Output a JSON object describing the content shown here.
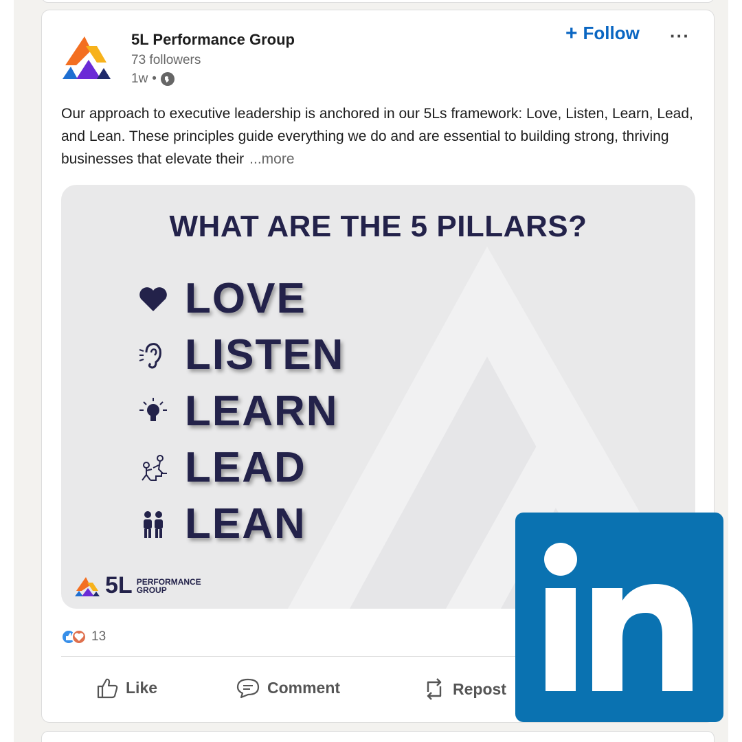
{
  "post": {
    "org_name": "5L Performance Group",
    "followers": "73 followers",
    "time": "1w",
    "separator": "•",
    "follow_label": "Follow",
    "more_menu": "···",
    "text": "Our approach to executive leadership is anchored in our 5Ls framework: Love, Listen, Learn, Lead, and Lean. These principles guide everything we do and are essential to building strong, thriving businesses that elevate their",
    "see_more": "...more"
  },
  "image": {
    "title": "WHAT ARE THE 5 PILLARS?",
    "pillars": [
      {
        "label": "LOVE",
        "icon": "heart-icon"
      },
      {
        "label": "LISTEN",
        "icon": "ear-icon"
      },
      {
        "label": "LEARN",
        "icon": "lightbulb-icon"
      },
      {
        "label": "LEAD",
        "icon": "climbing-people-icon"
      },
      {
        "label": "LEAN",
        "icon": "two-people-icon"
      }
    ],
    "logo_5l": "5L",
    "logo_line1": "PERFORMANCE",
    "logo_line2": "GROUP"
  },
  "social": {
    "reaction_count": "13",
    "like": "Like",
    "comment": "Comment",
    "repost": "Repost"
  },
  "colors": {
    "accent": "#0a66c2",
    "navy": "#23224a",
    "linkedin_blue": "#0a72b1"
  }
}
